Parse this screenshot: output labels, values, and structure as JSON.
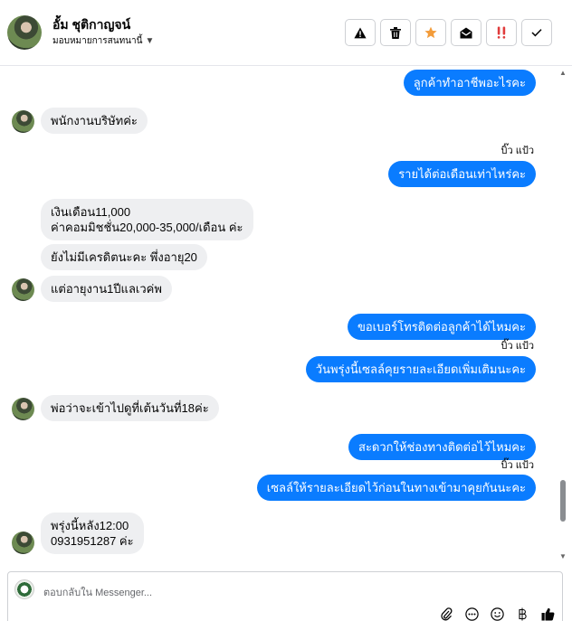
{
  "header": {
    "contact_name": "อั้ม ชุติกาญจน์",
    "assign_label": "มอบหมายการสนทนานี้",
    "actions": [
      {
        "name": "report-icon"
      },
      {
        "name": "trash-icon"
      },
      {
        "name": "star-icon"
      },
      {
        "name": "mark-unread-icon"
      },
      {
        "name": "priority-icon"
      },
      {
        "name": "check-icon"
      }
    ]
  },
  "colors": {
    "outgoing_bubble": "#0a7cff",
    "incoming_bubble": "#eeeff1",
    "star": "#f39c3a",
    "priority": "#e03c3c"
  },
  "messages": {
    "m1": "ลูกค้าทำอาชีพอะไรคะ",
    "m2": "พนักงานบริษัทค่ะ",
    "seen1": "บิ๊ว แป้ว",
    "m3": "รายได้ต่อเดือนเท่าไหร่คะ",
    "m4_line1": "เงินเดือน11,000",
    "m4_line2": "ค่าคอมมิชชั่น20,000-35,000/เดือน ค่ะ",
    "m5": "ยังไม่มีเครดิตนะคะ พึ่งอายุ20",
    "m6": "แต่อายุงาน1ปีแลเวค่พ",
    "m7": "ขอเบอร์โทรติดต่อลูกค้าได้ไหมคะ",
    "seen2": "บิ๊ว แป้ว",
    "m8": "วันพรุ่งนี้เซลล์คุยรายละเอียดเพิ่มเติมนะคะ",
    "m9": "พ่อว่าจะเข้าไปดูที่เต้นวันที่18ค่ะ",
    "m10": "สะดวกให้ช่องทางติดต่อไว้ไหมคะ",
    "seen3": "บิ๊ว แป้ว",
    "m11": "เซลล์ให้รายละเอียดไว้ก่อนในทางเข้ามาคุยกันนะคะ",
    "m12_line1": "พรุ่งนี้หลัง12:00",
    "m12_line2": "0931951287 ค่ะ"
  },
  "composer": {
    "placeholder": "ตอบกลับใน Messenger...",
    "tools": [
      "attach-icon",
      "more-icon",
      "emoji-icon",
      "currency-icon",
      "like-icon"
    ]
  }
}
